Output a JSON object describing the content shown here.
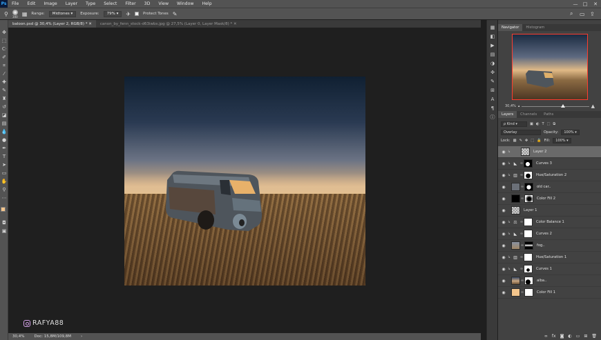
{
  "menu": {
    "logo": "Ps",
    "items": [
      "File",
      "Edit",
      "Image",
      "Layer",
      "Type",
      "Select",
      "Filter",
      "3D",
      "View",
      "Window",
      "Help"
    ],
    "win_controls": [
      "—",
      "□",
      "✕"
    ]
  },
  "options": {
    "brush_size": "300",
    "range_label": "Range:",
    "range_value": "Midtones",
    "exposure_label": "Exposure:",
    "exposure_value": "79%",
    "protect_tones": "Protect Tones"
  },
  "tabs": [
    {
      "label": "baloon.psd @ 30,4% (Layer 2, RGB/8) *  ✕",
      "active": true
    },
    {
      "label": "canon_by_fenn_stock-d63iwbs.jpg @ 27,5% (Layer 0, Layer Mask/8) *  ✕",
      "active": false
    }
  ],
  "status": {
    "zoom": "30,4%",
    "doc": "Doc: 15,8M/109,8M",
    "arrow": "›"
  },
  "watermark": "RAFYA88",
  "colors": {
    "foreground": "#f3c58c",
    "background": "#ffffff",
    "nav_highlight": "#ff3c2e"
  },
  "navigator": {
    "tabs": [
      "Navigator",
      "Histogram"
    ],
    "zoom": "30,4%"
  },
  "layers_panel": {
    "tabs": [
      "Layers",
      "Channels",
      "Paths"
    ],
    "kind": "ρ Kind",
    "blend_mode": "Overlay",
    "opacity_label": "Opacity:",
    "opacity": "100%",
    "lock_label": "Lock:",
    "fill_label": "Fill:",
    "fill": "100%",
    "layers": [
      {
        "name": "Layer 2",
        "selected": true,
        "clipped": true,
        "type": "pixel"
      },
      {
        "name": "Curves 3",
        "clipped": true,
        "type": "curves"
      },
      {
        "name": "Hue/Saturation 2",
        "clipped": true,
        "type": "huesat"
      },
      {
        "name": "old car..",
        "clipped": false,
        "type": "image"
      },
      {
        "name": "Color Fill 2",
        "clipped": false,
        "type": "fill"
      },
      {
        "name": "Layer 1",
        "clipped": false,
        "type": "pixel"
      },
      {
        "name": "Color Balance 1",
        "clipped": true,
        "type": "balance"
      },
      {
        "name": "Curves 2",
        "clipped": true,
        "type": "curves"
      },
      {
        "name": "fog..",
        "clipped": false,
        "type": "image"
      },
      {
        "name": "Hue/Saturation 1",
        "clipped": true,
        "type": "huesat"
      },
      {
        "name": "Curves 1",
        "clipped": true,
        "type": "curves"
      },
      {
        "name": "alba..",
        "clipped": false,
        "type": "image"
      },
      {
        "name": "Color Fill 1",
        "clipped": false,
        "type": "fill"
      }
    ]
  }
}
